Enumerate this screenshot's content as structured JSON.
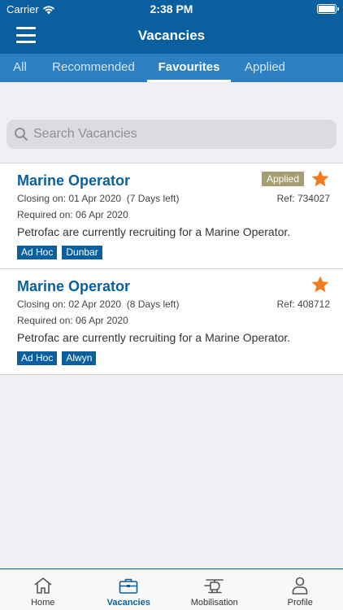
{
  "status_bar": {
    "carrier": "Carrier",
    "time": "2:38 PM"
  },
  "header": {
    "title": "Vacancies"
  },
  "tabs": [
    {
      "label": "All"
    },
    {
      "label": "Recommended"
    },
    {
      "label": "Favourites"
    },
    {
      "label": "Applied"
    }
  ],
  "search": {
    "placeholder": "Search Vacancies"
  },
  "vacancies": [
    {
      "title": "Marine Operator",
      "closing": "Closing on: 01 Apr 2020  (7 Days left)",
      "required": "Required on: 06 Apr 2020",
      "description": "Petrofac are currently recruiting for a Marine Operator.",
      "ref": "Ref: 734027",
      "status_badge": "Applied",
      "tags": [
        "Ad Hoc",
        "Dunbar"
      ]
    },
    {
      "title": "Marine Operator",
      "closing": "Closing on: 02 Apr 2020  (8 Days left)",
      "required": "Required on: 06 Apr 2020",
      "description": "Petrofac are currently recruiting for a Marine Operator.",
      "ref": "Ref: 408712",
      "tags": [
        "Ad Hoc",
        "Alwyn"
      ]
    }
  ],
  "bottom_nav": [
    {
      "label": "Home",
      "icon": "home-icon"
    },
    {
      "label": "Vacancies",
      "icon": "briefcase-icon"
    },
    {
      "label": "Mobilisation",
      "icon": "helicopter-icon"
    },
    {
      "label": "Profile",
      "icon": "person-icon"
    }
  ],
  "colors": {
    "primary": "#0a5f9e",
    "tab_bar": "#2c7fc0",
    "star": "#f47b20",
    "applied_badge": "#a89d72"
  }
}
